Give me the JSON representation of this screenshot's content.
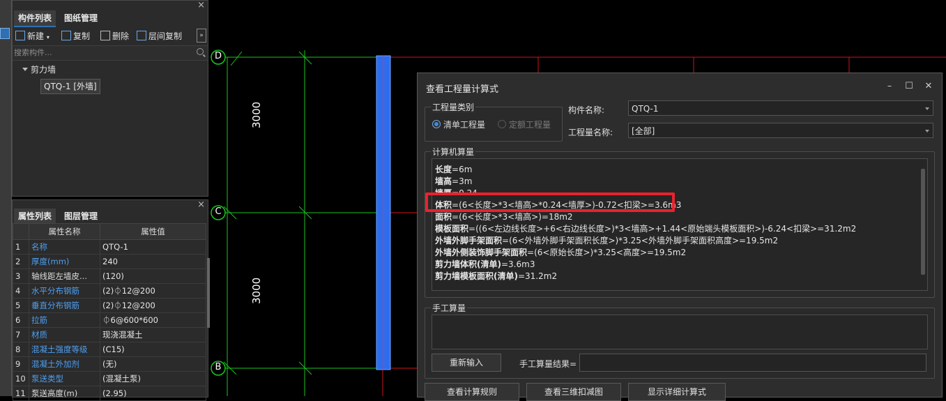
{
  "component_panel": {
    "tabs": [
      "构件列表",
      "图纸管理"
    ],
    "close": "×",
    "toolbar": {
      "new": "新建",
      "copy": "复制",
      "delete": "删除",
      "floor_copy": "层间复制",
      "more": "»"
    },
    "search_placeholder": "搜索构件...",
    "tree_group": "剪力墙",
    "tree_item": "QTQ-1 [外墙]"
  },
  "property_panel": {
    "tabs": [
      "属性列表",
      "图层管理"
    ],
    "close": "×",
    "headers": [
      "属性名称",
      "属性值"
    ],
    "rows": [
      {
        "num": "1",
        "name": "名称",
        "value": "QTQ-1",
        "blue": true
      },
      {
        "num": "2",
        "name": "厚度(mm)",
        "value": "240",
        "blue": true
      },
      {
        "num": "3",
        "name": "轴线距左墙皮...",
        "value": "(120)",
        "blue": false
      },
      {
        "num": "4",
        "name": "水平分布钢筋",
        "value": "(2)⏀12@200",
        "blue": true
      },
      {
        "num": "5",
        "name": "垂直分布钢筋",
        "value": "(2)⏀12@200",
        "blue": true
      },
      {
        "num": "6",
        "name": "拉筋",
        "value": "⏀6@600*600",
        "blue": true
      },
      {
        "num": "7",
        "name": "材质",
        "value": "现浇混凝土",
        "blue": true
      },
      {
        "num": "8",
        "name": "混凝土强度等级",
        "value": "(C15)",
        "blue": true
      },
      {
        "num": "9",
        "name": "混凝土外加剂",
        "value": "(无)",
        "blue": true
      },
      {
        "num": "10",
        "name": "泵送类型",
        "value": "(混凝土泵)",
        "blue": true
      },
      {
        "num": "11",
        "name": "泵送高度(m)",
        "value": "(2.95)",
        "blue": false
      }
    ]
  },
  "cad": {
    "axis_labels": [
      "D",
      "C",
      "B"
    ],
    "dimensions": [
      "3000",
      "3000"
    ]
  },
  "dialog": {
    "title": "查看工程量计算式",
    "controls": {
      "minimize": "–",
      "maximize": "☐",
      "close": "✕"
    },
    "quantity_type_group": "工程量类别",
    "radio_list": "清单工程量",
    "radio_quota": "定额工程量",
    "component_name_label": "构件名称:",
    "component_name_value": "QTQ-1",
    "quantity_name_label": "工程量名称:",
    "quantity_name_value": "[全部]",
    "computer_calc_group": "计算机算量",
    "calc_lines": [
      {
        "label": "长度",
        "formula": "=6m"
      },
      {
        "label": "墙高",
        "formula": "=3m"
      },
      {
        "label": "墙厚",
        "formula": "=0.24"
      },
      {
        "label": "体积",
        "formula": "=(6<长度>*3<墙高>*0.24<墙厚>)-0.72<扣梁>=3.6m3"
      },
      {
        "label": "面积",
        "formula": "=(6<长度>*3<墙高>)=18m2"
      },
      {
        "label": "模板面积",
        "formula": "=((6<左边线长度>+6<右边线长度>)*3<墙高>+1.44<原始端头模板面积>)-6.24<扣梁>=31.2m2"
      },
      {
        "label": "外墙外脚手架面积",
        "formula": "=(6<外墙外脚手架面积长度>)*3.25<外墙外脚手架面积高度>=19.5m2"
      },
      {
        "label": "外墙外侧装饰脚手架面积",
        "formula": "=(6<原始长度>)*3.25<高度>=19.5m2"
      },
      {
        "label": "剪力墙体积(清单)",
        "formula": "=3.6m3"
      },
      {
        "label": "剪力墙模板面积(清单)",
        "formula": "=31.2m2"
      }
    ],
    "manual_calc_group": "手工算量",
    "reinput_button": "重新输入",
    "manual_result_label": "手工算量结果=",
    "bottom_buttons": [
      "查看计算规则",
      "查看三维扣减图",
      "显示详细计算式"
    ]
  },
  "colors": {
    "accent_blue": "#2f6fb2",
    "highlight_red": "#e8232d",
    "grid_green": "#19c61e",
    "grid_red": "#d0151c"
  }
}
